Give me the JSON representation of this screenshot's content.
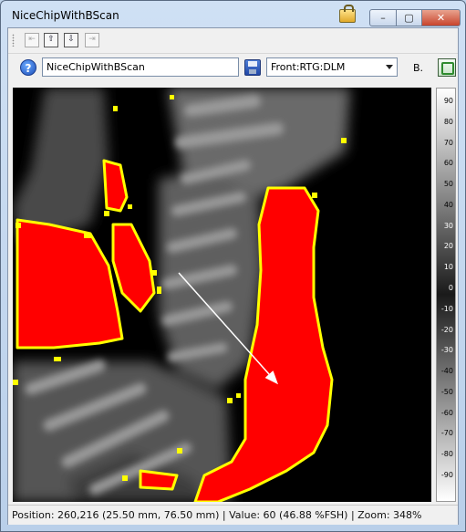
{
  "window": {
    "title": "NiceChipWithBScan"
  },
  "caption_buttons": {
    "minimize": "–",
    "maximize": "▢",
    "close": "✕"
  },
  "toolbar": {
    "buttons": [
      "first-frame",
      "prev-frame",
      "next-frame",
      "last-frame"
    ]
  },
  "scan_name": {
    "value": "NiceChipWithBScan"
  },
  "view_select": {
    "selected": "Front:RTG:DLM"
  },
  "b_label": "B.",
  "color_scale": {
    "labels": [
      "90",
      "80",
      "70",
      "60",
      "50",
      "40",
      "30",
      "20",
      "10",
      "0",
      "-10",
      "-20",
      "-30",
      "-40",
      "-50",
      "-60",
      "-70",
      "-80",
      "-90"
    ]
  },
  "status": {
    "text": "Position: 260,216 (25.50 mm, 76.50 mm)  |  Value: 60 (46.88 %FSH)  |  Zoom: 348%"
  },
  "colors": {
    "accent": "#ff0000",
    "outline": "#ffff00",
    "background": "#000000"
  }
}
